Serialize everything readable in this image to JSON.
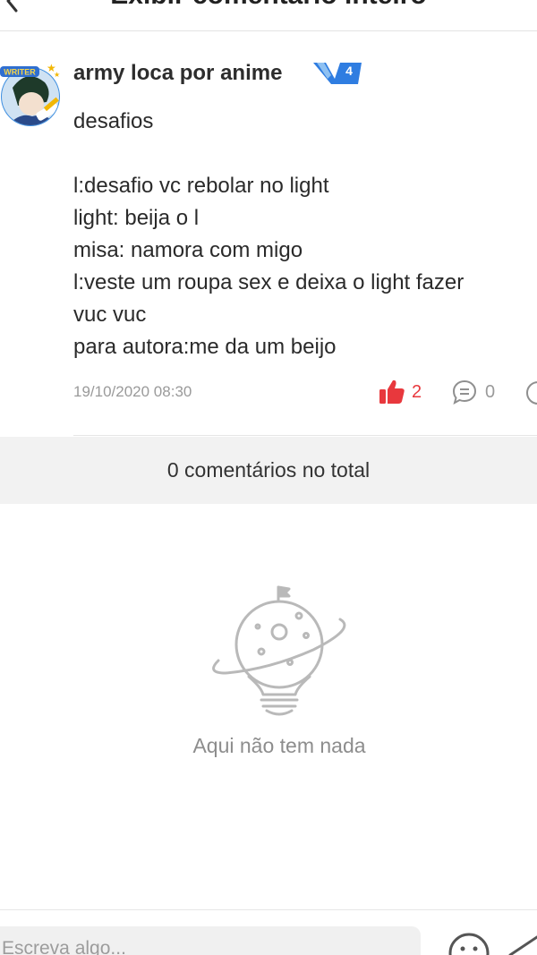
{
  "header": {
    "title": "Exibir comentário inteiro"
  },
  "comment": {
    "author": "army loca por anime",
    "level": "4",
    "lines": [
      "desafios",
      "",
      "l:desafio vc rebolar no light",
      "light: beija o l",
      "misa: namora com migo",
      "l:veste um roupa sex e deixa o light fazer",
      "vuc vuc",
      "para autora:me da um beijo"
    ],
    "timestamp": "19/10/2020 08:30",
    "likes": "2",
    "replies": "0"
  },
  "total": {
    "label": "0 comentários no total"
  },
  "empty": {
    "label": "Aqui não tem nada"
  },
  "input": {
    "placeholder": "Escreva algo..."
  },
  "icons": {
    "back": "chevron-left-icon",
    "like": "thumbs-up-icon",
    "reply": "comment-bubble-icon",
    "more": "more-icon",
    "emoji": "emoji-icon",
    "send": "send-icon",
    "empty": "planet-lightbulb-icon"
  },
  "colors": {
    "like": "#e8383d",
    "badge": "#2f7de1",
    "muted": "#9a9a9a",
    "total_bg": "#f2f2f2"
  }
}
